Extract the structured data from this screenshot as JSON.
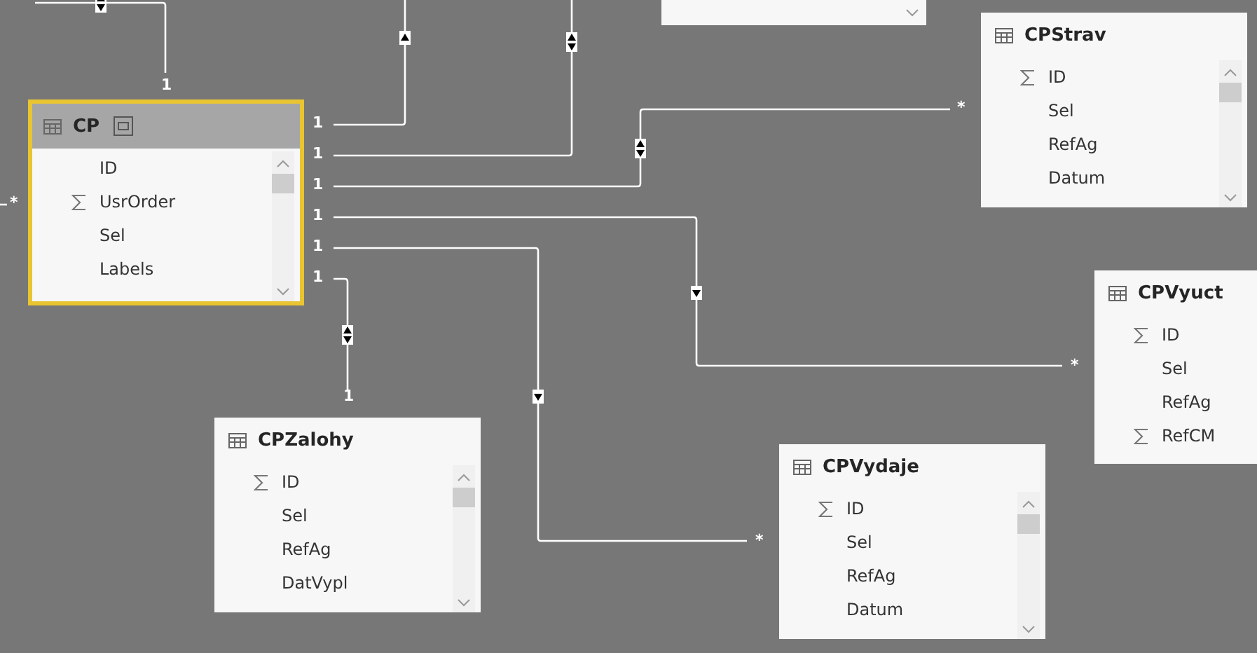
{
  "tables": [
    {
      "name": "CP",
      "selected": true,
      "fields": [
        {
          "name": "ID",
          "sum": false
        },
        {
          "name": "UsrOrder",
          "sum": true
        },
        {
          "name": "Sel",
          "sum": false
        },
        {
          "name": "Labels",
          "sum": false
        }
      ]
    },
    {
      "name": "CPStrav",
      "selected": false,
      "fields": [
        {
          "name": "ID",
          "sum": true
        },
        {
          "name": "Sel",
          "sum": false
        },
        {
          "name": "RefAg",
          "sum": false
        },
        {
          "name": "Datum",
          "sum": false
        }
      ]
    },
    {
      "name": "CPVyuct",
      "selected": false,
      "fields": [
        {
          "name": "ID",
          "sum": true
        },
        {
          "name": "Sel",
          "sum": false
        },
        {
          "name": "RefAg",
          "sum": false
        },
        {
          "name": "RefCM",
          "sum": true
        }
      ]
    },
    {
      "name": "CPZalohy",
      "selected": false,
      "fields": [
        {
          "name": "ID",
          "sum": true
        },
        {
          "name": "Sel",
          "sum": false
        },
        {
          "name": "RefAg",
          "sum": false
        },
        {
          "name": "DatVypl",
          "sum": false
        }
      ]
    },
    {
      "name": "CPVydaje",
      "selected": false,
      "fields": [
        {
          "name": "ID",
          "sum": true
        },
        {
          "name": "Sel",
          "sum": false
        },
        {
          "name": "RefAg",
          "sum": false
        },
        {
          "name": "Datum",
          "sum": false
        }
      ]
    }
  ],
  "cardinality_labels": [
    "1",
    "*",
    "1",
    "1",
    "1",
    "1",
    "1",
    "1",
    "1",
    "*",
    "*",
    "*"
  ]
}
